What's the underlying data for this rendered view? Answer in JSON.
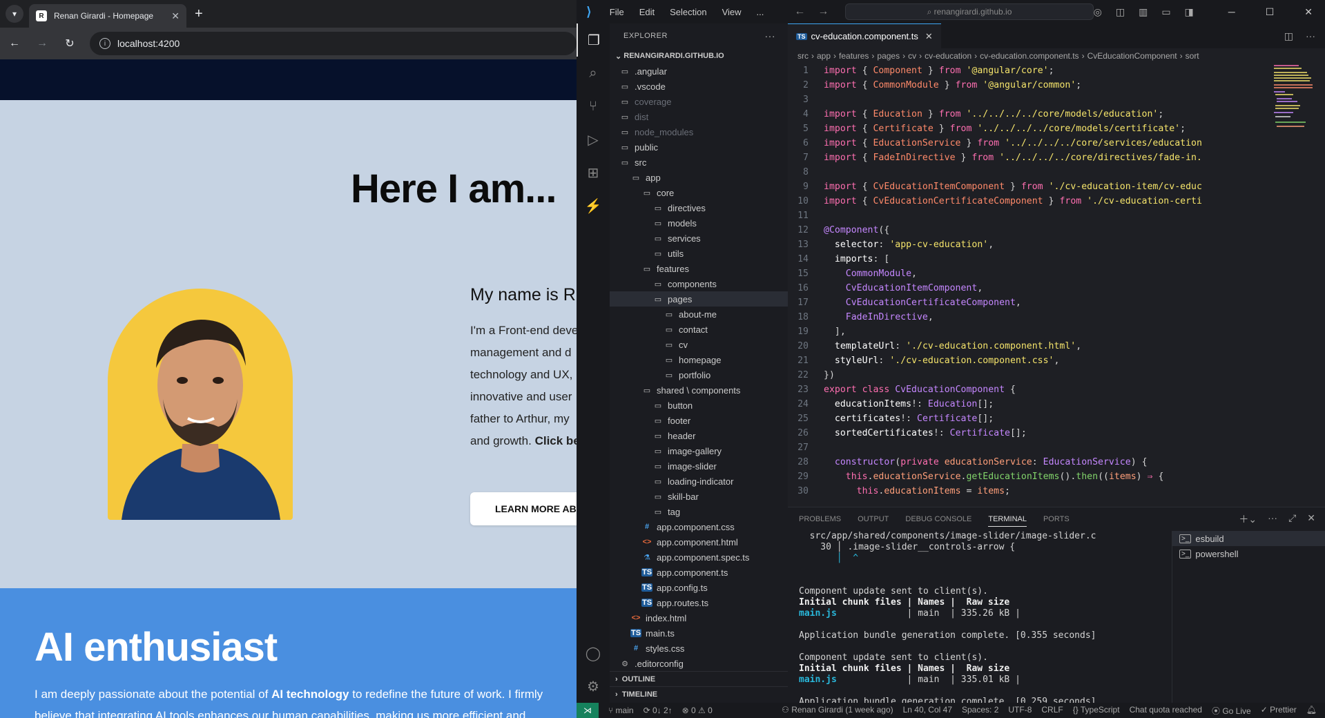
{
  "browser": {
    "tab_title": "Renan Girardi - Homepage",
    "url": "localhost:4200",
    "hero_title": "Here I am...",
    "intro_name": "My name is R",
    "intro_lines": [
      "I'm a Front-end deve",
      "management and d",
      "technology and UX,",
      "innovative and user",
      "father to Arthur, my"
    ],
    "intro_last_plain": "and growth.",
    "intro_last_bold": "Click be",
    "learn_more": "LEARN MORE ABO",
    "ai_title": "AI enthusiast",
    "ai_text_1": "I am deeply passionate about the potential of",
    "ai_text_bold": "AI technology",
    "ai_text_2": "to redefine the future of work. I firmly believe that integrating AI tools enhances our human capabilities, making us more efficient and"
  },
  "vscode": {
    "menu": [
      "File",
      "Edit",
      "Selection",
      "View",
      "..."
    ],
    "command_center": "renangirardi.github.io",
    "explorer_title": "EXPLORER",
    "root": "RENANGIRARDI.GITHUB.IO",
    "tree": [
      {
        "name": ".angular",
        "kind": "folder",
        "depth": 0
      },
      {
        "name": ".vscode",
        "kind": "folder",
        "depth": 0
      },
      {
        "name": "coverage",
        "kind": "folder",
        "depth": 0,
        "dim": true
      },
      {
        "name": "dist",
        "kind": "folder",
        "depth": 0,
        "dim": true
      },
      {
        "name": "node_modules",
        "kind": "folder",
        "depth": 0,
        "dim": true
      },
      {
        "name": "public",
        "kind": "folder",
        "depth": 0
      },
      {
        "name": "src",
        "kind": "folder-open",
        "depth": 0
      },
      {
        "name": "app",
        "kind": "folder-open",
        "depth": 1
      },
      {
        "name": "core",
        "kind": "folder-open",
        "depth": 2
      },
      {
        "name": "directives",
        "kind": "folder",
        "depth": 3
      },
      {
        "name": "models",
        "kind": "folder",
        "depth": 3
      },
      {
        "name": "services",
        "kind": "folder",
        "depth": 3
      },
      {
        "name": "utils",
        "kind": "folder",
        "depth": 3
      },
      {
        "name": "features",
        "kind": "folder-open",
        "depth": 2
      },
      {
        "name": "components",
        "kind": "folder",
        "depth": 3
      },
      {
        "name": "pages",
        "kind": "folder-open",
        "depth": 3,
        "selected": true
      },
      {
        "name": "about-me",
        "kind": "folder",
        "depth": 4
      },
      {
        "name": "contact",
        "kind": "folder",
        "depth": 4
      },
      {
        "name": "cv",
        "kind": "folder",
        "depth": 4
      },
      {
        "name": "homepage",
        "kind": "folder",
        "depth": 4
      },
      {
        "name": "portfolio",
        "kind": "folder",
        "depth": 4
      },
      {
        "name": "shared \\ components",
        "kind": "folder-open",
        "depth": 2
      },
      {
        "name": "button",
        "kind": "folder",
        "depth": 3
      },
      {
        "name": "footer",
        "kind": "folder",
        "depth": 3
      },
      {
        "name": "header",
        "kind": "folder",
        "depth": 3
      },
      {
        "name": "image-gallery",
        "kind": "folder",
        "depth": 3
      },
      {
        "name": "image-slider",
        "kind": "folder",
        "depth": 3
      },
      {
        "name": "loading-indicator",
        "kind": "folder",
        "depth": 3
      },
      {
        "name": "skill-bar",
        "kind": "folder",
        "depth": 3
      },
      {
        "name": "tag",
        "kind": "folder",
        "depth": 3
      },
      {
        "name": "app.component.css",
        "kind": "css",
        "depth": 2
      },
      {
        "name": "app.component.html",
        "kind": "html",
        "depth": 2
      },
      {
        "name": "app.component.spec.ts",
        "kind": "spec",
        "depth": 2
      },
      {
        "name": "app.component.ts",
        "kind": "ts",
        "depth": 2
      },
      {
        "name": "app.config.ts",
        "kind": "ts",
        "depth": 2
      },
      {
        "name": "app.routes.ts",
        "kind": "ts",
        "depth": 2
      },
      {
        "name": "index.html",
        "kind": "html",
        "depth": 1
      },
      {
        "name": "main.ts",
        "kind": "ts",
        "depth": 1
      },
      {
        "name": "styles.css",
        "kind": "css",
        "depth": 1
      },
      {
        "name": ".editorconfig",
        "kind": "misc",
        "depth": 0
      }
    ],
    "outline": "OUTLINE",
    "timeline": "TIMELINE",
    "editor_tab": "cv-education.component.ts",
    "breadcrumb": [
      "src",
      "app",
      "features",
      "pages",
      "cv",
      "cv-education",
      "cv-education.component.ts",
      "CvEducationComponent",
      "sort"
    ],
    "panel_tabs": [
      "PROBLEMS",
      "OUTPUT",
      "DEBUG CONSOLE",
      "TERMINAL",
      "PORTS"
    ],
    "terminal_lines": [
      {
        "t": "  src/app/shared/components/image-slider/image-slider.c",
        "c": ""
      },
      {
        "t": "    30 │ .image-slider__controls-arrow {",
        "c": ""
      },
      {
        "t": "       │  ^",
        "c": "cyan"
      },
      {
        "t": "",
        "c": ""
      },
      {
        "t": "",
        "c": ""
      },
      {
        "t": "Component update sent to client(s).",
        "c": ""
      },
      {
        "t": "Initial chunk files | Names |  Raw size",
        "c": "b"
      },
      {
        "t": "main.js",
        "c": "cyanb",
        "rest": "             | main  | 335.26 kB |"
      },
      {
        "t": "",
        "c": ""
      },
      {
        "t": "Application bundle generation complete. [0.355 seconds]",
        "c": ""
      },
      {
        "t": "",
        "c": ""
      },
      {
        "t": "Component update sent to client(s).",
        "c": ""
      },
      {
        "t": "Initial chunk files | Names |  Raw size",
        "c": "b"
      },
      {
        "t": "main.js",
        "c": "cyanb",
        "rest": "             | main  | 335.01 kB |"
      },
      {
        "t": "",
        "c": ""
      },
      {
        "t": "Application bundle generation complete. [0.259 seconds]",
        "c": ""
      }
    ],
    "terminals": [
      "esbuild",
      "powershell"
    ],
    "status": {
      "branch": "main",
      "sync": "0↓ 2↑",
      "problems": "⊗ 0 ⚠ 0",
      "blame": "Renan Girardi (1 week ago)",
      "position": "Ln 40, Col 47",
      "spaces": "Spaces: 2",
      "encoding": "UTF-8",
      "eol": "CRLF",
      "language": "TypeScript",
      "quota": "Chat quota reached",
      "golive": "Go Live",
      "prettier": "Prettier"
    }
  }
}
